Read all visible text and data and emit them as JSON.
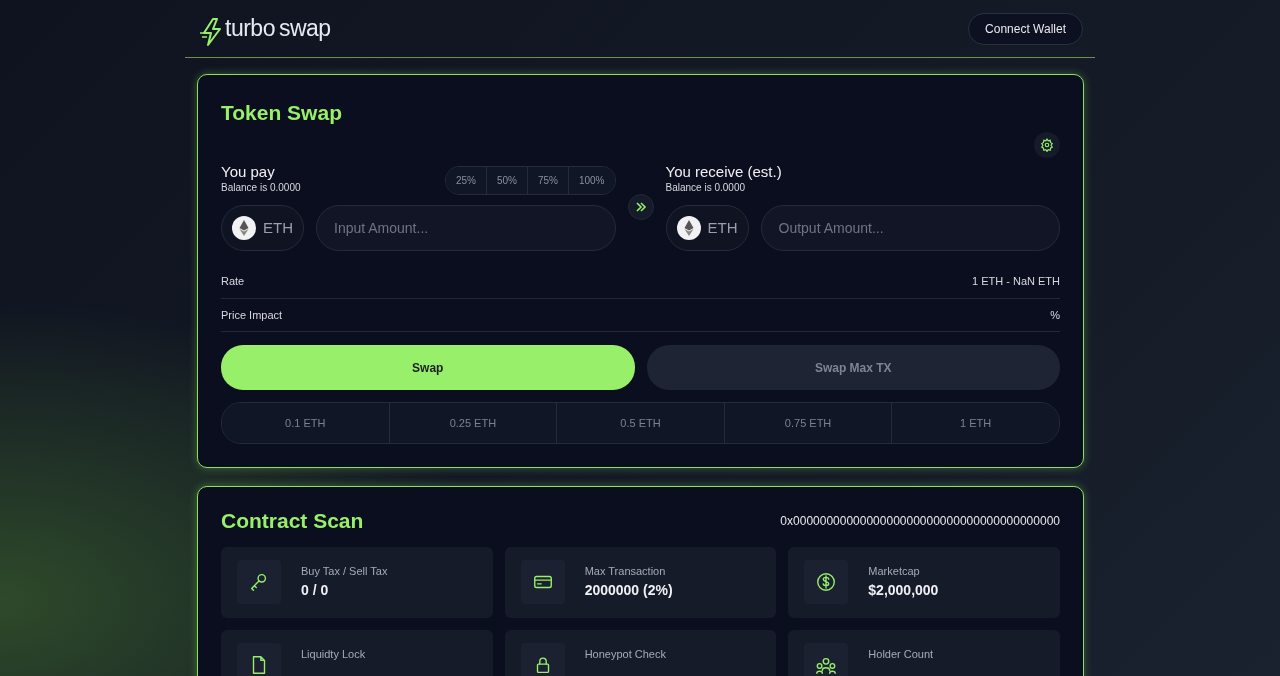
{
  "header": {
    "logo_text_1": "turbo",
    "logo_text_2": "swap",
    "connect_button": "Connect Wallet"
  },
  "swap": {
    "title": "Token Swap",
    "pay": {
      "label": "You pay",
      "balance": "Balance is 0.0000",
      "token": "ETH",
      "placeholder": "Input Amount..."
    },
    "percent_buttons": [
      "25%",
      "50%",
      "75%",
      "100%"
    ],
    "receive": {
      "label": "You receive (est.)",
      "balance": "Balance is 0.0000",
      "token": "ETH",
      "placeholder": "Output Amount..."
    },
    "info_rows": [
      {
        "label": "Rate",
        "value": "1 ETH - NaN ETH"
      },
      {
        "label": "Price Impact",
        "value": "%"
      }
    ],
    "actions": [
      {
        "label": "Swap",
        "kind": "primary"
      },
      {
        "label": "Swap Max TX",
        "kind": "secondary"
      }
    ],
    "presets": [
      "0.1 ETH",
      "0.25 ETH",
      "0.5 ETH",
      "0.75 ETH",
      "1 ETH"
    ]
  },
  "scan": {
    "title": "Contract Scan",
    "address": "0x0000000000000000000000000000000000000000",
    "items": [
      {
        "label": "Buy Tax / Sell Tax",
        "value": "0 / 0"
      },
      {
        "label": "Max Transaction",
        "value": "2000000 (2%)"
      },
      {
        "label": "Marketcap",
        "value": "$2,000,000"
      },
      {
        "label": "Liquidty Lock"
      },
      {
        "label": "Honeypot Check"
      },
      {
        "label": "Holder Count"
      }
    ]
  }
}
